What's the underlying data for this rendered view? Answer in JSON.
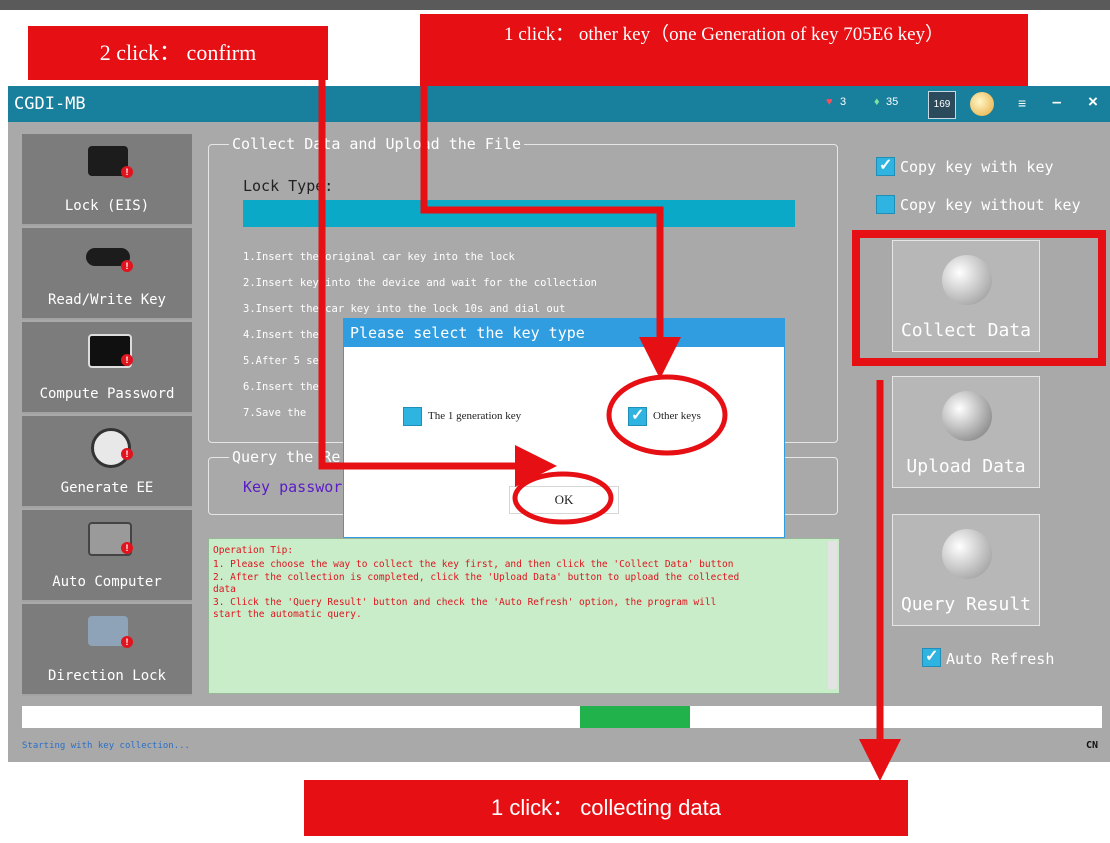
{
  "annotations": {
    "confirm_banner": "2 click： confirm",
    "other_key_banner": "1 click：  other key（one Generation of key 705E6 key）",
    "collecting_banner": "1  click： collecting data"
  },
  "titlebar": {
    "title": "CGDI-MB",
    "heart_count": "3",
    "gem_count": "35",
    "time_badge": "169"
  },
  "sidebar": {
    "items": [
      {
        "label": "Lock (EIS)"
      },
      {
        "label": "Read/Write Key"
      },
      {
        "label": "Compute Password"
      },
      {
        "label": "Generate EE"
      },
      {
        "label": "Auto Computer"
      },
      {
        "label": "Direction Lock"
      }
    ]
  },
  "collect": {
    "legend": "Collect Data and Upload the File",
    "lock_type_label": "Lock Type:",
    "steps": [
      "1.Insert the original car key into the lock",
      "2.Insert key into the device and wait for the collection",
      "3.Insert the car key into the lock 10s and dial out",
      "4.Insert the",
      "5.After 5 sec",
      "6.Insert the",
      "7.Save the"
    ]
  },
  "query": {
    "legend": "Query the Re",
    "key_password_label": "Key passwor"
  },
  "tip": {
    "title": "Operation Tip:",
    "lines": [
      "1. Please choose the way to collect the key first, and then click the 'Collect Data' button",
      "2. After the collection is completed, click the 'Upload Data' button to upload the collected",
      "   data",
      "3. Click the 'Query Result' button and check the 'Auto Refresh' option, the program will",
      "   start the automatic query."
    ]
  },
  "options": {
    "copy_with_key": "Copy key with key",
    "copy_without_key": "Copy key without key",
    "copy_with_key_checked": true,
    "copy_without_key_checked": false
  },
  "buttons": {
    "collect_data": "Collect Data",
    "upload_data": "Upload  Data",
    "query_result": "Query Result",
    "auto_refresh": "Auto Refresh",
    "auto_refresh_checked": true
  },
  "status": {
    "text": "Starting with key collection...",
    "language": "CN",
    "progress_fraction": 0.1
  },
  "modal": {
    "title": "Please select the key type",
    "option1": "The 1 generation key",
    "option2": "Other keys",
    "option1_checked": false,
    "option2_checked": true,
    "ok": "OK"
  },
  "colors": {
    "annotation_red": "#e60f14",
    "titlebar": "#187f9c",
    "progress": "#22b24c",
    "dialog_header": "#2f9ddf"
  }
}
